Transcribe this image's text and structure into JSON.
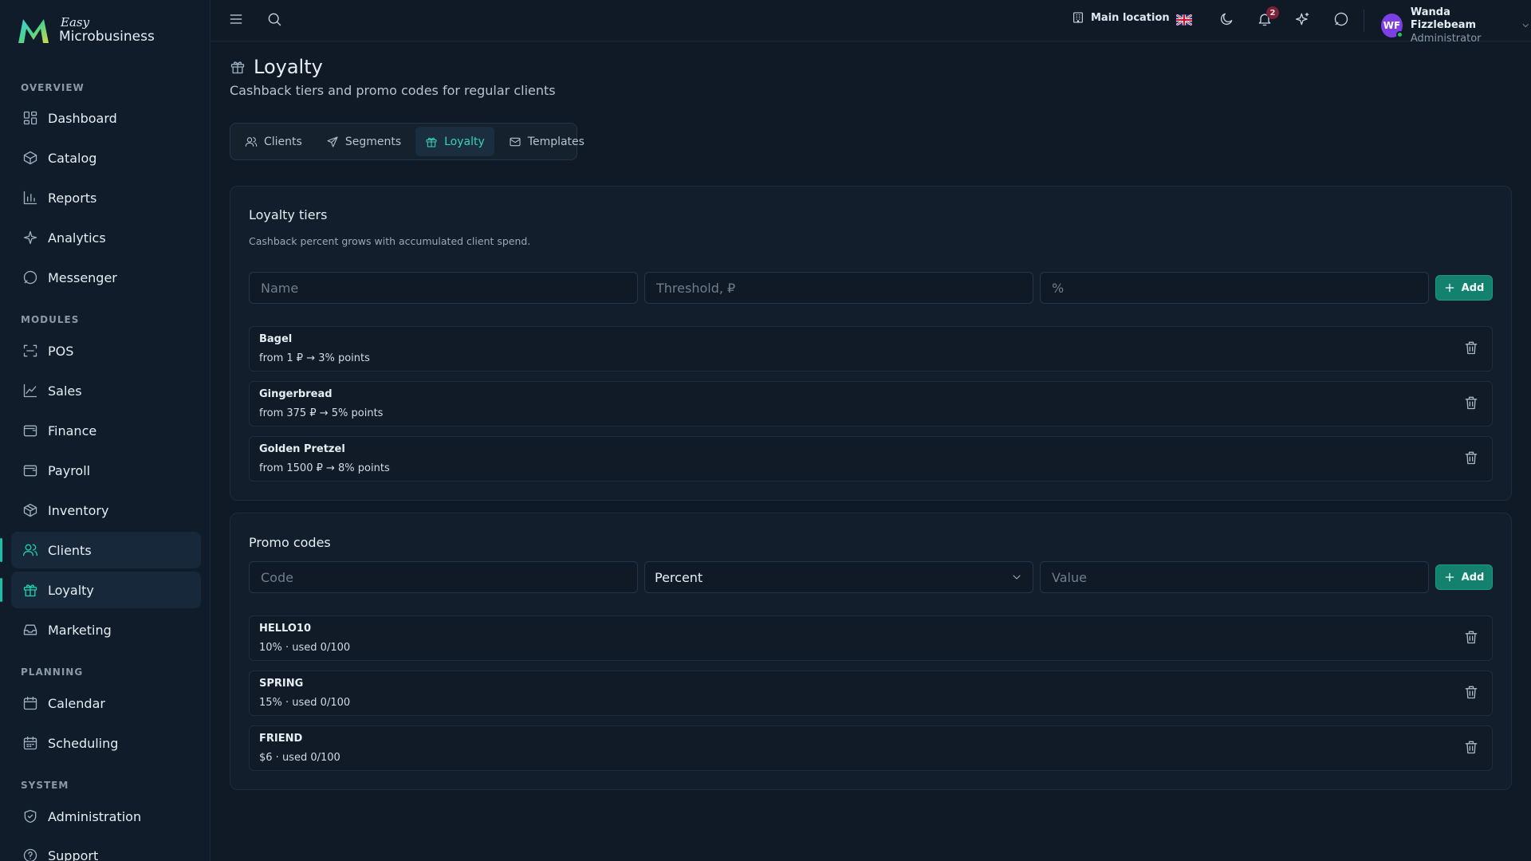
{
  "brand": {
    "easy": "Easy",
    "name": "Microbusiness"
  },
  "sidebar": {
    "sections": [
      {
        "label": "OVERVIEW"
      },
      {
        "label": "MODULES"
      },
      {
        "label": "PLANNING"
      },
      {
        "label": "SYSTEM"
      }
    ],
    "items": [
      {
        "label": "Dashboard",
        "icon": "dashboard-icon"
      },
      {
        "label": "Catalog",
        "icon": "catalog-icon"
      },
      {
        "label": "Reports",
        "icon": "reports-icon"
      },
      {
        "label": "Analytics",
        "icon": "analytics-icon"
      },
      {
        "label": "Messenger",
        "icon": "messenger-icon"
      },
      {
        "label": "POS",
        "icon": "scan-icon"
      },
      {
        "label": "Sales",
        "icon": "sales-chart-icon"
      },
      {
        "label": "Finance",
        "icon": "wallet-icon"
      },
      {
        "label": "Payroll",
        "icon": "wallet-icon"
      },
      {
        "label": "Inventory",
        "icon": "box-icon"
      },
      {
        "label": "Clients",
        "icon": "users-icon"
      },
      {
        "label": "Loyalty",
        "icon": "gift-icon"
      },
      {
        "label": "Marketing",
        "icon": "inbox-icon"
      },
      {
        "label": "Calendar",
        "icon": "calendar-icon"
      },
      {
        "label": "Scheduling",
        "icon": "calendar-grid-icon"
      },
      {
        "label": "Administration",
        "icon": "shield-icon"
      },
      {
        "label": "Support",
        "icon": "help-icon"
      }
    ]
  },
  "topbar": {
    "location": "Main location",
    "notifications_count": "2",
    "user": {
      "initials": "WF",
      "name": "Wanda Fizzlebeam",
      "role": "Administrator"
    }
  },
  "page": {
    "title": "Loyalty",
    "subtitle": "Cashback tiers and promo codes for regular clients"
  },
  "tabs": [
    {
      "label": "Clients"
    },
    {
      "label": "Segments"
    },
    {
      "label": "Loyalty"
    },
    {
      "label": "Templates"
    }
  ],
  "tiers": {
    "title": "Loyalty tiers",
    "description": "Cashback percent grows with accumulated client spend.",
    "name_placeholder": "Name",
    "threshold_placeholder": "Threshold, ₽",
    "percent_placeholder": "%",
    "add_label": "Add",
    "items": [
      {
        "name": "Bagel",
        "detail": "from 1 ₽ → 3% points"
      },
      {
        "name": "Gingerbread",
        "detail": "from 375 ₽ → 5% points"
      },
      {
        "name": "Golden Pretzel",
        "detail": "from 1500 ₽ → 8% points"
      }
    ]
  },
  "promo": {
    "title": "Promo codes",
    "code_placeholder": "Code",
    "type_value": "Percent",
    "value_placeholder": "Value",
    "add_label": "Add",
    "items": [
      {
        "code": "HELLO10",
        "detail": "10% · used 0/100"
      },
      {
        "code": "SPRING",
        "detail": "15% · used 0/100"
      },
      {
        "code": "FRIEND",
        "detail": "$6 · used 0/100"
      }
    ]
  },
  "colors": {
    "accent": "#19c2a6",
    "background": "#0f1a26",
    "button": "#14806e"
  }
}
